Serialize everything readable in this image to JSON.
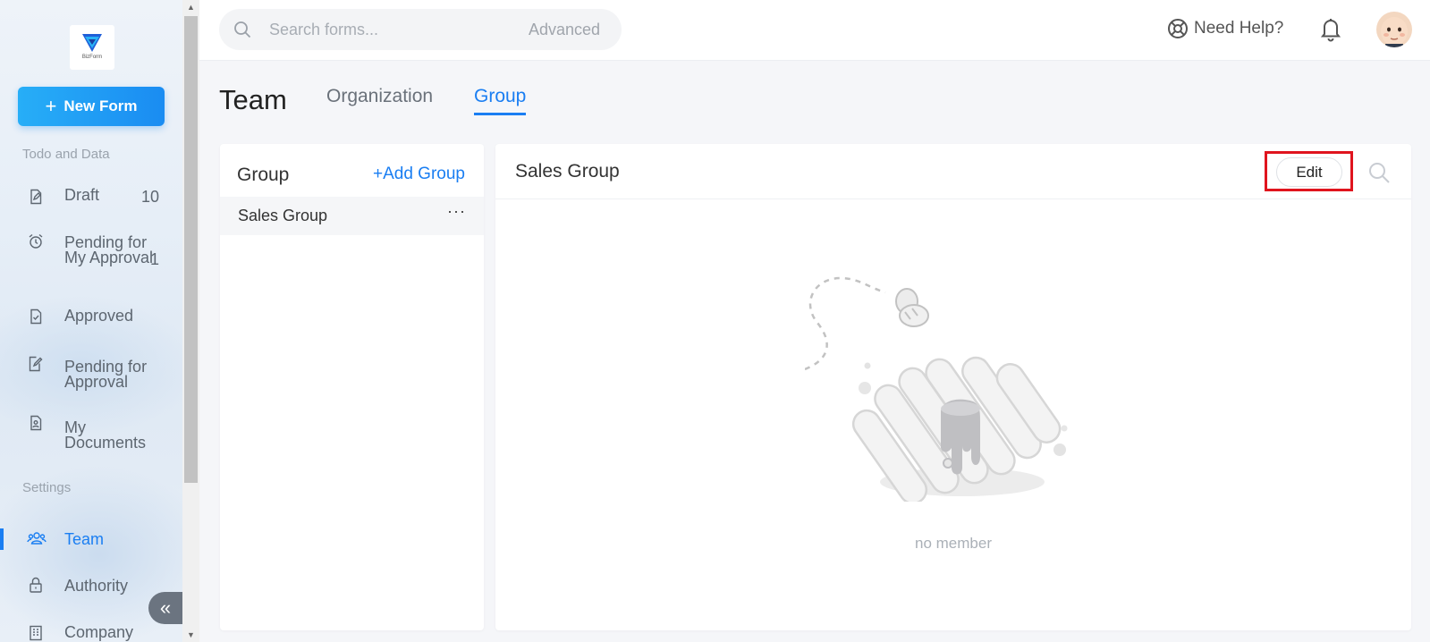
{
  "app": {
    "logo_text": "BizForm",
    "brand_color": "#1a7ef2"
  },
  "sidebar": {
    "new_form_label": "New Form",
    "section_todo": "Todo and Data",
    "section_settings": "Settings",
    "items": [
      {
        "label": "Draft",
        "count": "10",
        "icon": "draft-icon"
      },
      {
        "label": "Pending for My Approval",
        "count": "1",
        "icon": "alarm-clock-icon"
      },
      {
        "label": "Approved",
        "count": "",
        "icon": "approved-doc-icon"
      },
      {
        "label": "Pending for Approval",
        "count": "",
        "icon": "pending-doc-icon"
      },
      {
        "label": "My Documents",
        "count": "",
        "icon": "my-documents-icon"
      },
      {
        "label": "Team",
        "count": "",
        "icon": "team-icon",
        "active": true
      },
      {
        "label": "Authority",
        "count": "",
        "icon": "lock-icon"
      },
      {
        "label": "Company",
        "count": "",
        "icon": "building-icon"
      }
    ]
  },
  "header": {
    "search_placeholder": "Search forms...",
    "advanced_label": "Advanced",
    "help_label": "Need Help?"
  },
  "page": {
    "title": "Team",
    "tabs": [
      {
        "label": "Organization",
        "active": false
      },
      {
        "label": "Group",
        "active": true
      }
    ]
  },
  "group_panel": {
    "title": "Group",
    "add_label": "+Add Group",
    "groups": [
      {
        "name": "Sales Group",
        "more": "···"
      }
    ]
  },
  "detail_panel": {
    "title": "Sales Group",
    "edit_label": "Edit",
    "empty_text": "no member"
  }
}
